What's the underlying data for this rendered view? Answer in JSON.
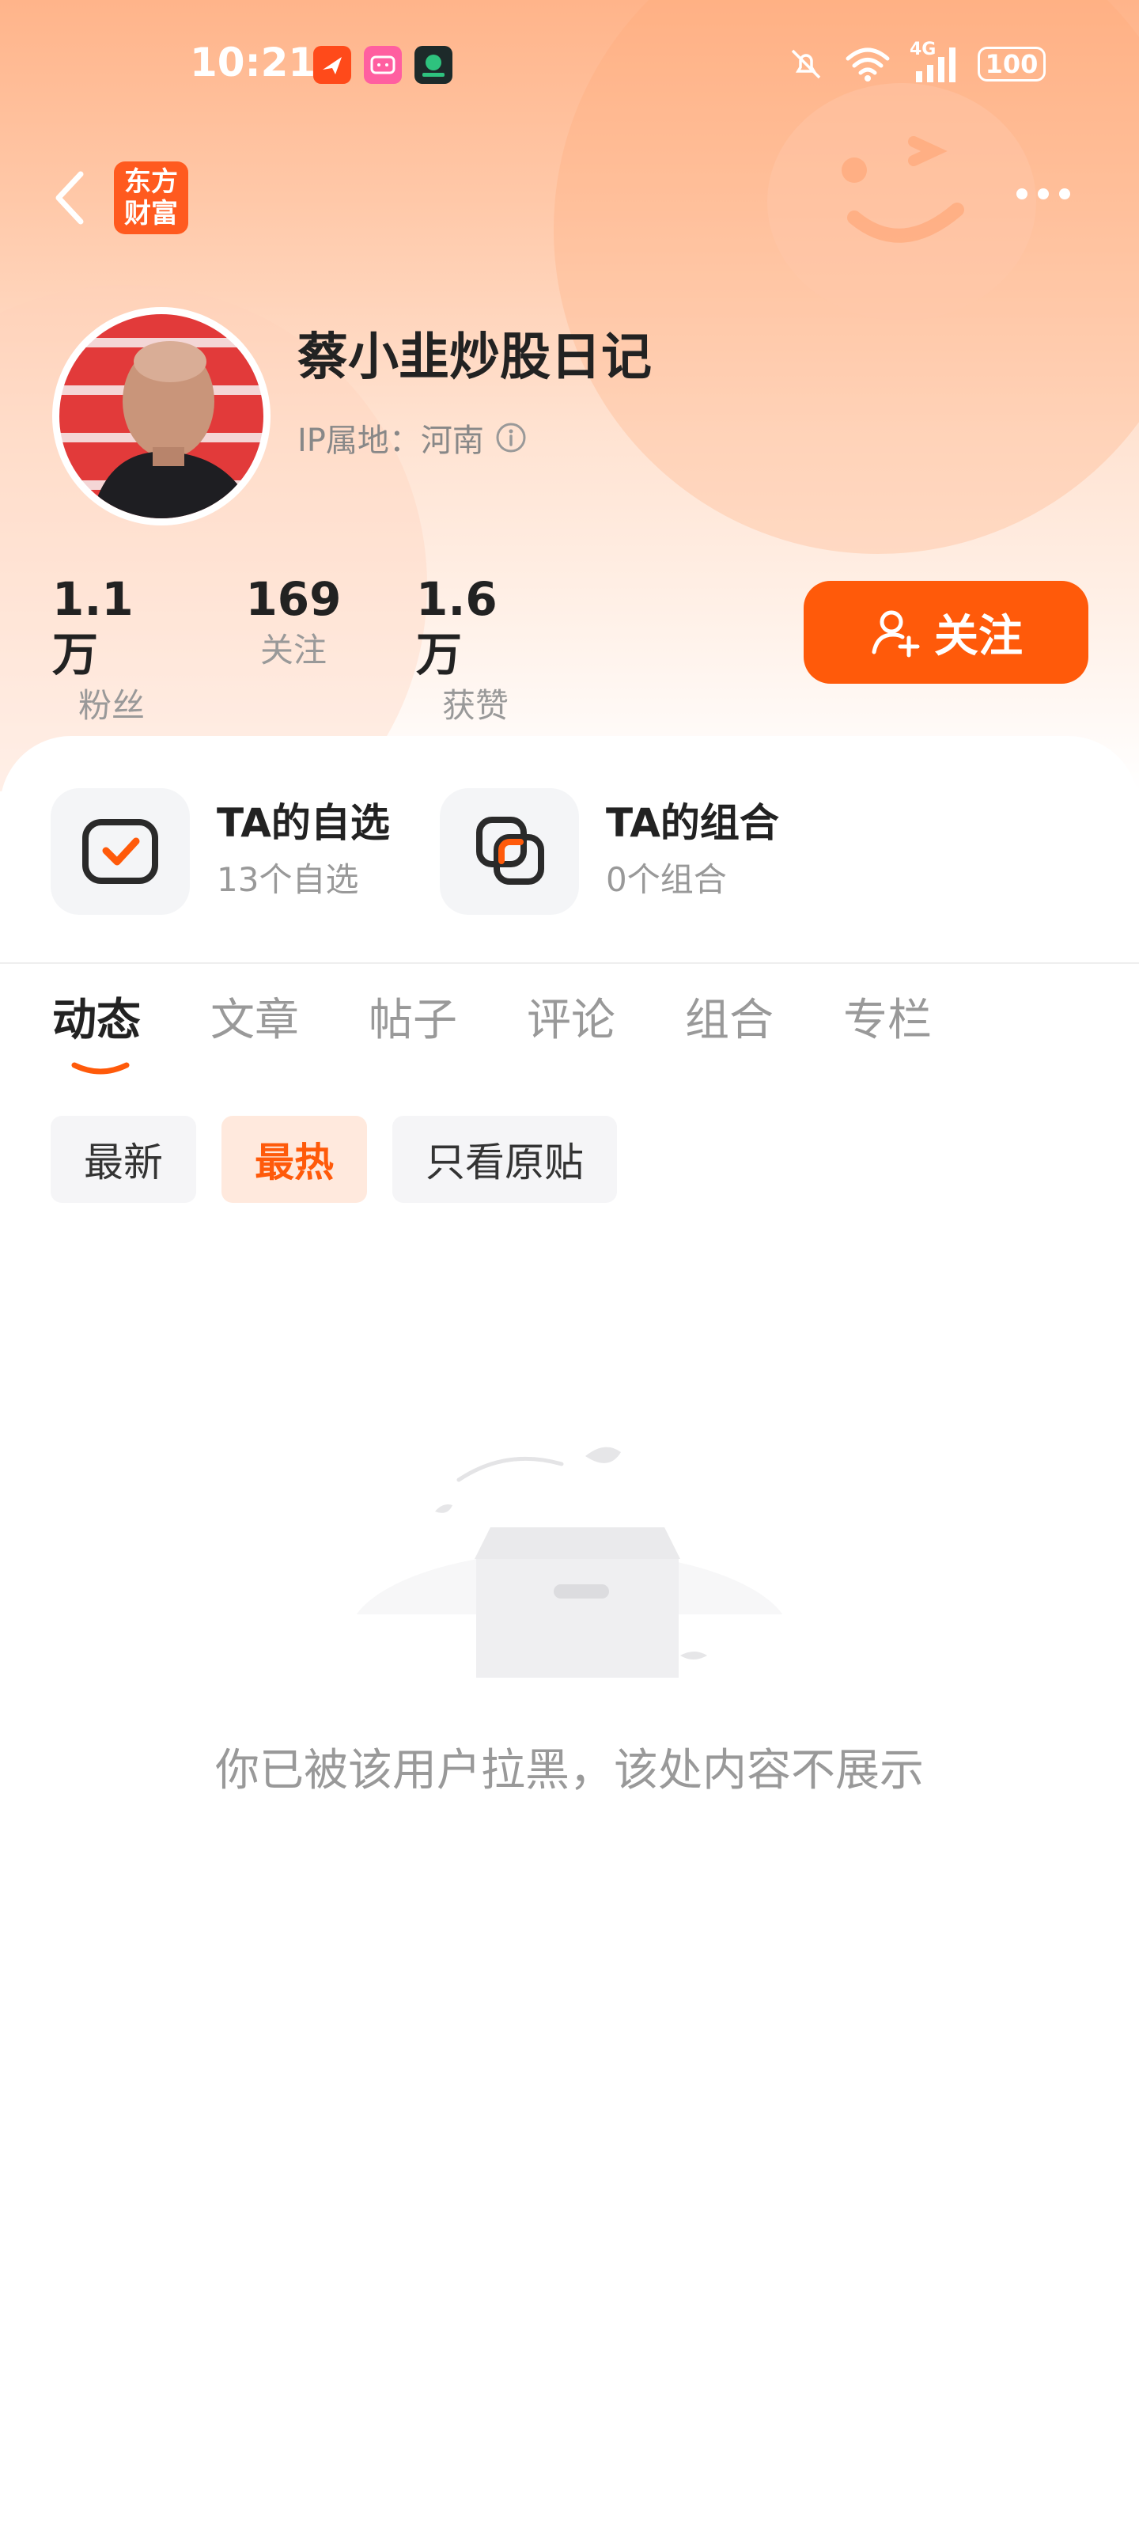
{
  "status_bar": {
    "time": "10:21",
    "network": "4G",
    "battery": "100",
    "icons": [
      "app-plane-icon",
      "app-bilibili-icon",
      "app-football-icon",
      "mute-bell-icon",
      "wifi-icon",
      "signal-icon",
      "battery-icon"
    ]
  },
  "nav": {
    "back_icon": "chevron-left-icon",
    "logo_line1": "东方",
    "logo_line2": "财富",
    "more_icon": "more-dots-icon"
  },
  "profile": {
    "username": "蔡小韭炒股日记",
    "ip_location": "IP属地：河南",
    "info_icon": "info-icon"
  },
  "stats": [
    {
      "value": "1.1万",
      "label": "粉丝"
    },
    {
      "value": "169",
      "label": "关注"
    },
    {
      "value": "1.6万",
      "label": "获赞"
    }
  ],
  "follow_button": {
    "label": "关注",
    "icon": "add-user-icon"
  },
  "features": [
    {
      "title": "TA的自选",
      "subtitle": "13个自选",
      "icon": "watchlist-check-icon"
    },
    {
      "title": "TA的组合",
      "subtitle": "0个组合",
      "icon": "portfolio-icon"
    }
  ],
  "tabs": [
    {
      "label": "动态",
      "active": true
    },
    {
      "label": "文章",
      "active": false
    },
    {
      "label": "帖子",
      "active": false
    },
    {
      "label": "评论",
      "active": false
    },
    {
      "label": "组合",
      "active": false
    },
    {
      "label": "专栏",
      "active": false
    }
  ],
  "filters": [
    {
      "label": "最新",
      "active": false
    },
    {
      "label": "最热",
      "active": true
    },
    {
      "label": "只看原贴",
      "active": false
    }
  ],
  "empty_state": {
    "message": "你已被该用户拉黑，该处内容不展示",
    "icon": "empty-box-icon"
  },
  "colors": {
    "accent": "#ff5a0a",
    "header_gradient_top": "#ffb48a",
    "text_primary": "#222222",
    "text_secondary": "#999999"
  }
}
